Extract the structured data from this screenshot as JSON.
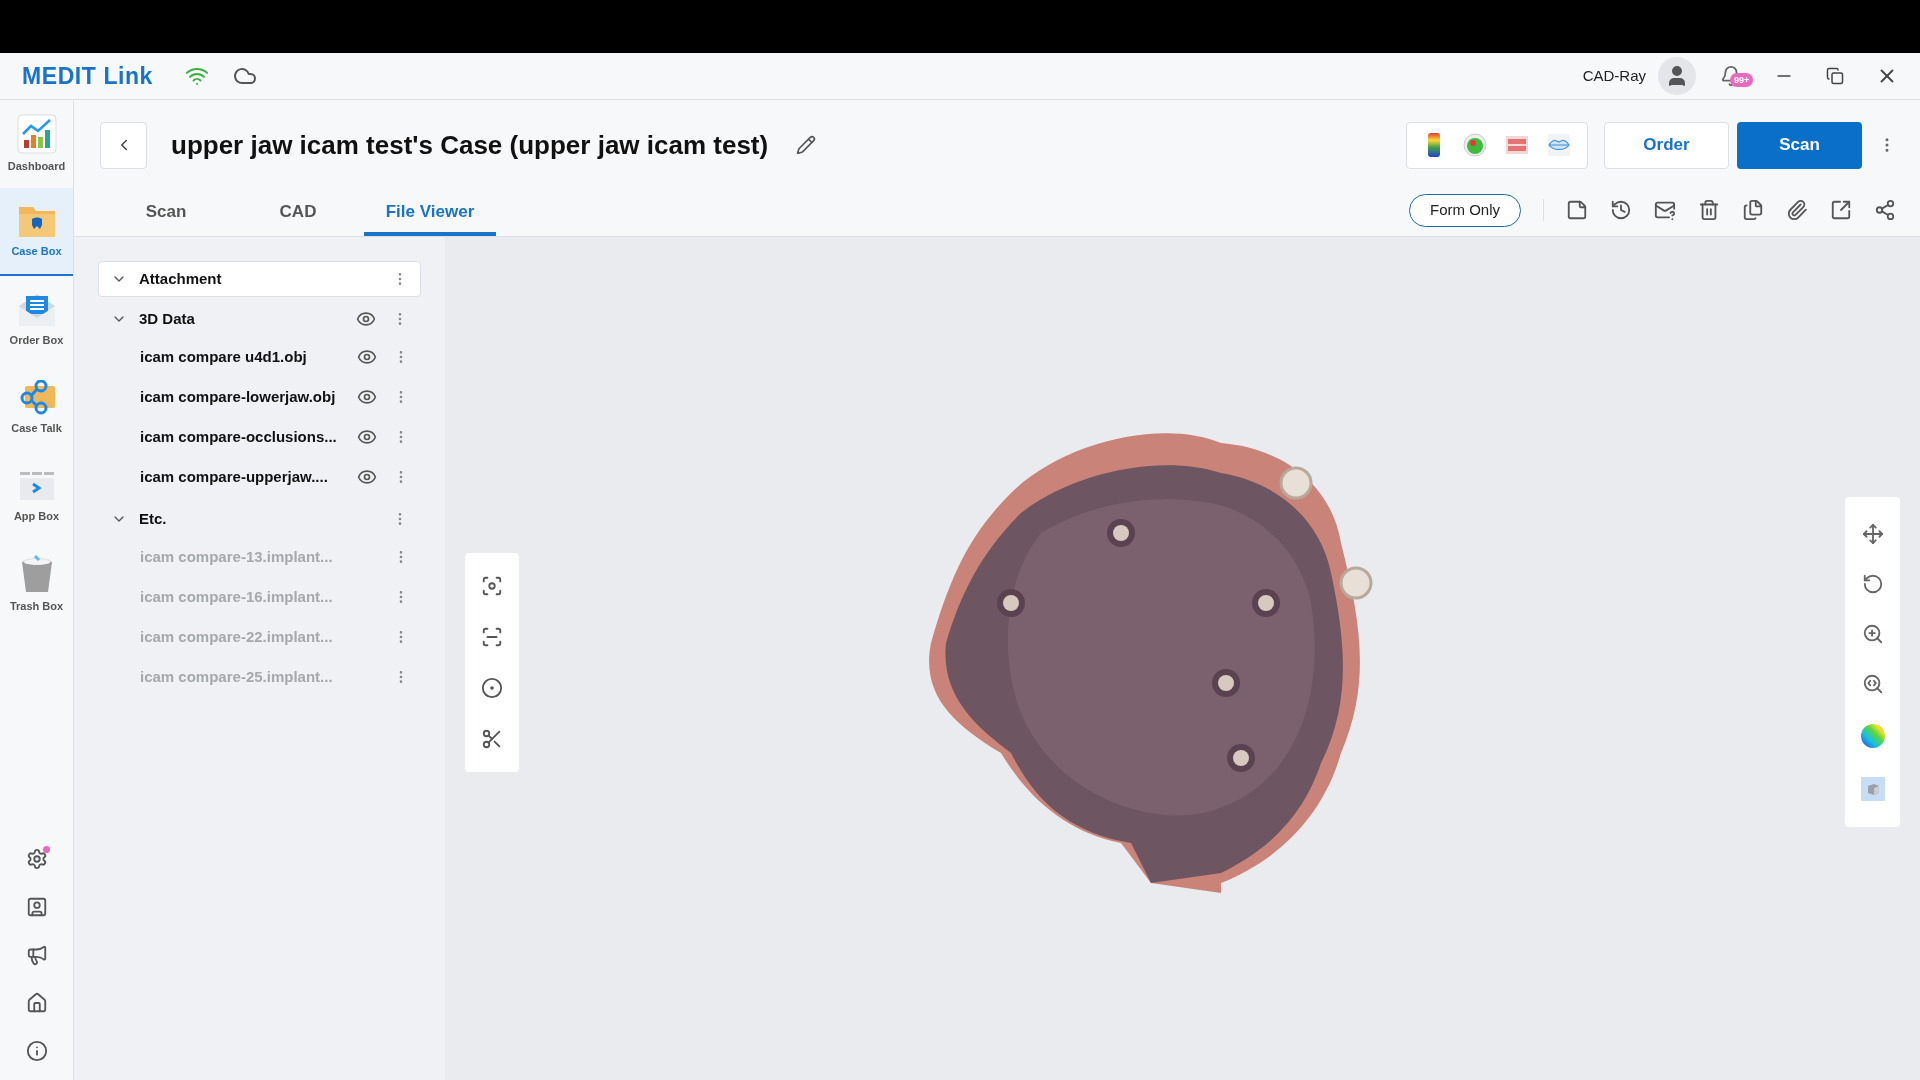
{
  "app": {
    "title": "MEDIT Link",
    "user": "CAD-Ray",
    "notifications": "99+"
  },
  "sidebar": {
    "items": [
      {
        "label": "Dashboard",
        "selected": false
      },
      {
        "label": "Case Box",
        "selected": true
      },
      {
        "label": "Order Box",
        "selected": false
      },
      {
        "label": "Case Talk",
        "selected": false
      },
      {
        "label": "App Box",
        "selected": false
      },
      {
        "label": "Trash Box",
        "selected": false
      }
    ]
  },
  "case": {
    "title": "upper jaw icam test's Case (upper jaw icam test)"
  },
  "tabs": [
    {
      "label": "Scan",
      "selected": false
    },
    {
      "label": "CAD",
      "selected": false
    },
    {
      "label": "File Viewer",
      "selected": true
    }
  ],
  "buttons": {
    "order": "Order",
    "scan": "Scan",
    "form_only": "Form Only"
  },
  "tree": [
    {
      "label": "Attachment",
      "expanded": true,
      "selected": true,
      "eye": false
    },
    {
      "label": "3D Data",
      "expanded": true,
      "selected": false,
      "eye": true,
      "children": [
        {
          "label": "icam compare u4d1.obj",
          "kind": "model"
        },
        {
          "label": "icam compare-lowerjaw.obj",
          "kind": "model"
        },
        {
          "label": "icam compare-occlusions...",
          "kind": "model"
        },
        {
          "label": "icam compare-upperjaw....",
          "kind": "model"
        }
      ]
    },
    {
      "label": "Etc.",
      "expanded": true,
      "selected": false,
      "eye": false,
      "children": [
        {
          "label": "icam compare-13.implant...",
          "kind": "file"
        },
        {
          "label": "icam compare-16.implant...",
          "kind": "file"
        },
        {
          "label": "icam compare-22.implant...",
          "kind": "file"
        },
        {
          "label": "icam compare-25.implant...",
          "kind": "file"
        }
      ]
    }
  ]
}
